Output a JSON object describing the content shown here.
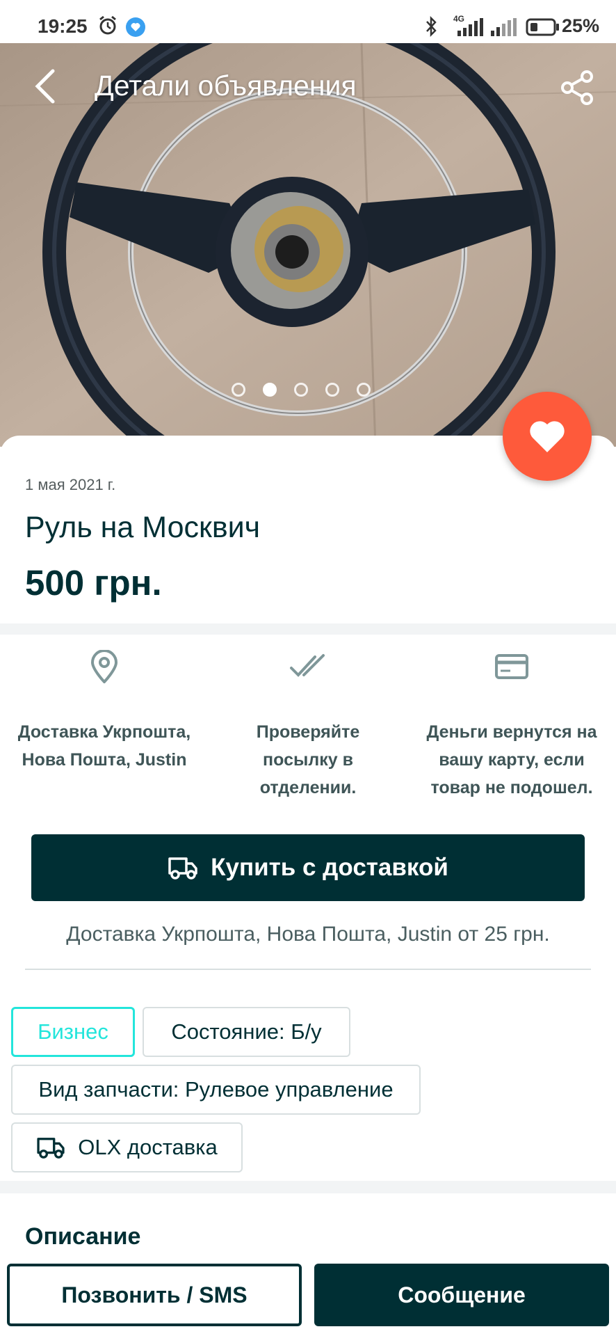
{
  "status_bar": {
    "time": "19:25",
    "battery": "25%",
    "network": "4G",
    "icons": [
      "alarm-icon",
      "messenger-icon",
      "bluetooth-icon",
      "signal-icon",
      "battery-icon"
    ]
  },
  "header": {
    "title": "Детали объявления",
    "back_icon": "back-arrow-icon",
    "share_icon": "share-icon"
  },
  "gallery": {
    "image_count": 5,
    "active_index": 2
  },
  "ad": {
    "date": "1 мая 2021 г.",
    "title": "Руль на Москвич",
    "price": "500 грн."
  },
  "features": [
    {
      "icon": "location-pin-icon",
      "text": "Доставка Укрпошта, Нова Пошта, Justin"
    },
    {
      "icon": "double-check-icon",
      "text": "Проверяйте посылку в отделении."
    },
    {
      "icon": "card-icon",
      "text": "Деньги вернутся на вашу карту, если товар не подошел."
    }
  ],
  "buy_button": {
    "label": "Купить с доставкой",
    "icon": "truck-icon"
  },
  "delivery_note": "Доставка Укрпошта, Нова Пошта, Justin от 25 грн.",
  "tags": {
    "business": "Бизнес",
    "condition": "Состояние: Б/у",
    "part_type": "Вид запчасти: Рулевое управление",
    "olx_delivery": "OLX доставка"
  },
  "description": {
    "heading": "Описание"
  },
  "actions": {
    "call": "Позвонить / SMS",
    "message": "Сообщение"
  },
  "colors": {
    "primary": "#002f34",
    "accent_teal": "#23e5db",
    "favorite": "#fe5a3b",
    "separator": "#f2f4f5"
  }
}
